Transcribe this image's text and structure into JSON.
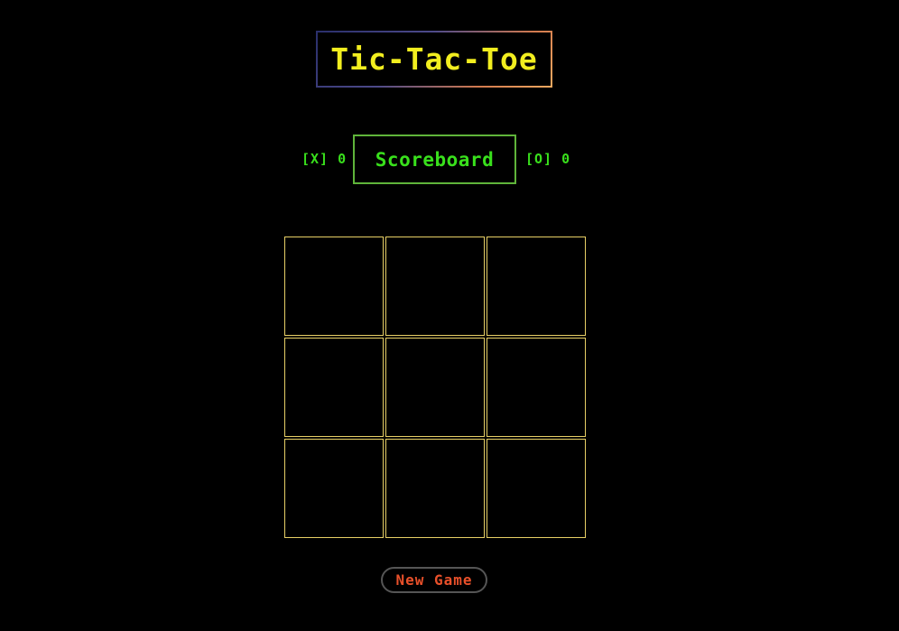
{
  "title": "Tic-Tac-Toe",
  "scoreboard": {
    "label": "Scoreboard",
    "x_label": "[X]",
    "x_score": "0",
    "o_label": "[O]",
    "o_score": "0"
  },
  "board": {
    "cells": [
      "",
      "",
      "",
      "",
      "",
      "",
      "",
      "",
      ""
    ]
  },
  "controls": {
    "new_game_label": "New Game"
  },
  "colors": {
    "background": "#000000",
    "title": "#f2ee1f",
    "score": "#39e01c",
    "cell_border": "#e8d066",
    "button_text": "#e8502a"
  }
}
